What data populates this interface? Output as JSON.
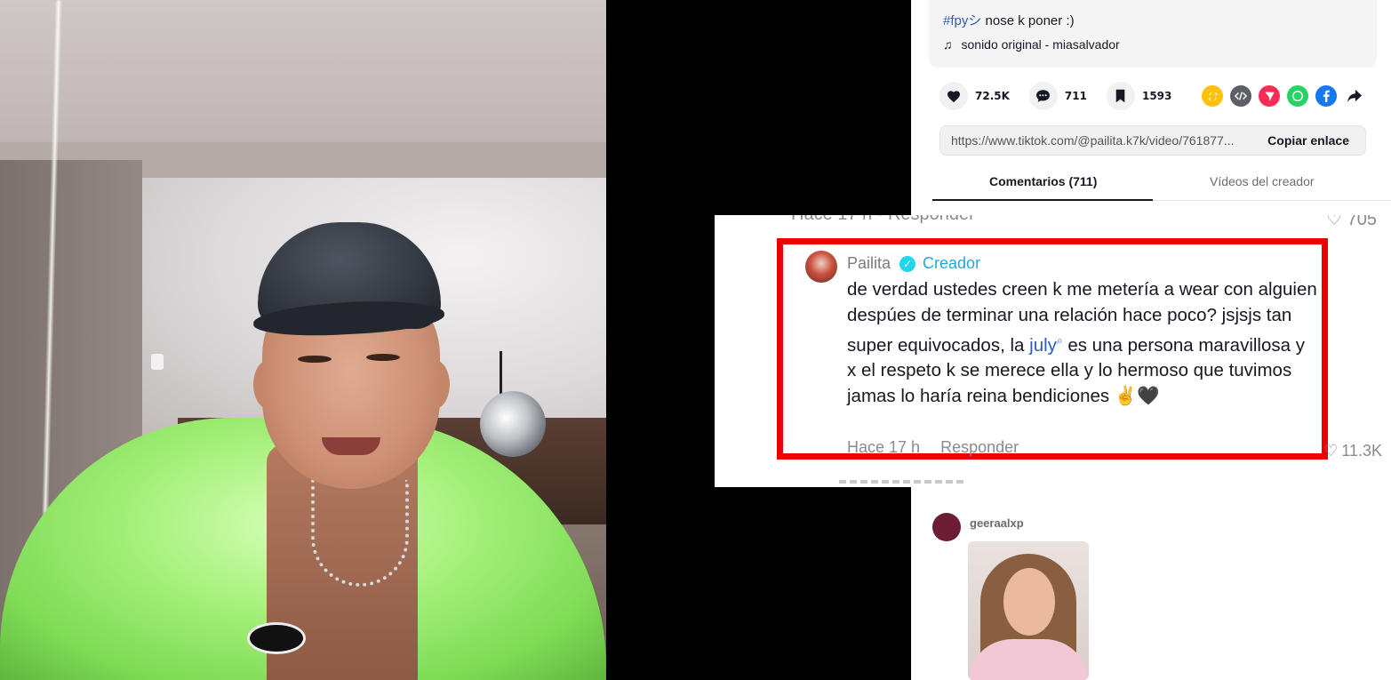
{
  "video": {
    "description_tag": "#fpyシ",
    "description_text": "nose k poner :)",
    "music": "sonido original - miasalvador"
  },
  "actions": {
    "likes": "72.5K",
    "comments": "711",
    "saves": "1593"
  },
  "share": {
    "link": "https://www.tiktok.com/@pailita.k7k/video/761877...",
    "copy_label": "Copiar enlace",
    "colors": {
      "repost": "#ffc107",
      "embed": "#5c5f66",
      "send": "#fe2c55",
      "whatsapp": "#25d366",
      "facebook": "#1877f2"
    }
  },
  "tabs": {
    "comments": "Comentarios (711)",
    "creator_videos": "Vídeos del creador"
  },
  "highlighted_comment": {
    "ghost_prev_meta": "Hace 17 h · Responder",
    "ghost_prev_likes": "705",
    "user": "Pailita",
    "badge": "Creador",
    "text_before": "de verdad ustedes creen k me metería a wear con alguien despúes de terminar una relación hace poco? jsjsjs tan super equivocados, la ",
    "mention": "july",
    "text_after": " es una persona maravillosa y x el respeto k se merece ella y lo hermoso que tuvimos jamas lo haría reina bendiciones ✌🖤",
    "time": "Hace 17 h",
    "reply_label": "Responder",
    "likes": "11.3K",
    "highlight_color": "#ee0000"
  },
  "next_comment": {
    "user": "geeraalxp"
  }
}
